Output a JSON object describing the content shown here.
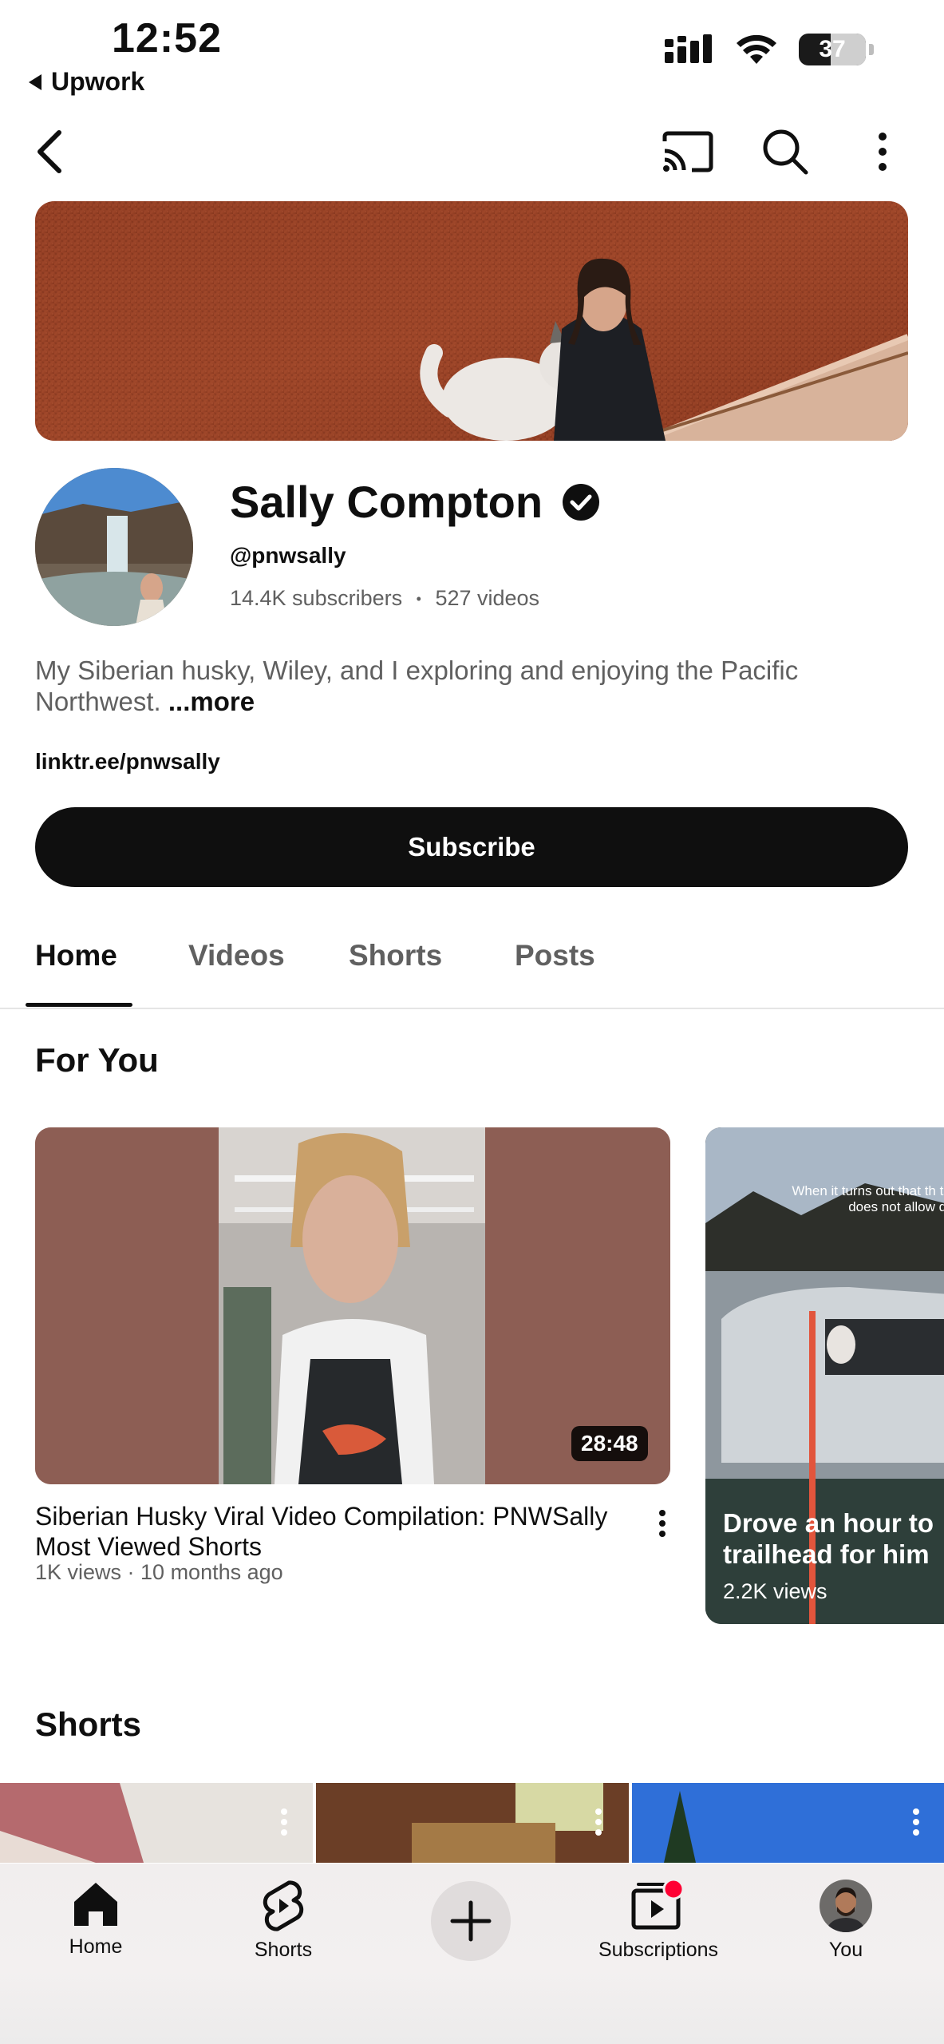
{
  "status_bar": {
    "time": "12:52",
    "back_app": "Upwork",
    "battery": "37"
  },
  "channel": {
    "name": "Sally Compton",
    "handle": "@pnwsally",
    "subscribers": "14.4K subscribers",
    "separator": "•",
    "videos": "527 videos",
    "description": "My Siberian husky, Wiley, and I exploring and enjoying the Pacific Northwest.",
    "more": "...more",
    "link": "linktr.ee/pnwsally",
    "subscribe_label": "Subscribe"
  },
  "tabs": [
    {
      "label": "Home"
    },
    {
      "label": "Videos"
    },
    {
      "label": "Shorts"
    },
    {
      "label": "Posts"
    }
  ],
  "for_you": {
    "title": "For You",
    "video": {
      "title": "Siberian Husky Viral Video Compilation: PNWSally Most Viewed Shorts",
      "meta": "1K views · 10 months ago",
      "duration": "28:48"
    },
    "short": {
      "caption": "When it turns out that th trail does not allow dog",
      "title_line1": "Drove an hour to",
      "title_line2": "trailhead for him",
      "views": "2.2K views"
    }
  },
  "shorts_section": {
    "title": "Shorts"
  },
  "bottom_nav": [
    {
      "label": "Home",
      "icon": "home-icon"
    },
    {
      "label": "Shorts",
      "icon": "shorts-icon"
    },
    {
      "label": "",
      "icon": "create-icon"
    },
    {
      "label": "Subscriptions",
      "icon": "subscriptions-icon"
    },
    {
      "label": "You",
      "icon": "avatar"
    }
  ],
  "colors": {
    "text_primary": "#0f0f0f",
    "text_secondary": "#606060",
    "subscribe_bg": "#0f0f0f",
    "notification_dot": "#ff0033"
  }
}
